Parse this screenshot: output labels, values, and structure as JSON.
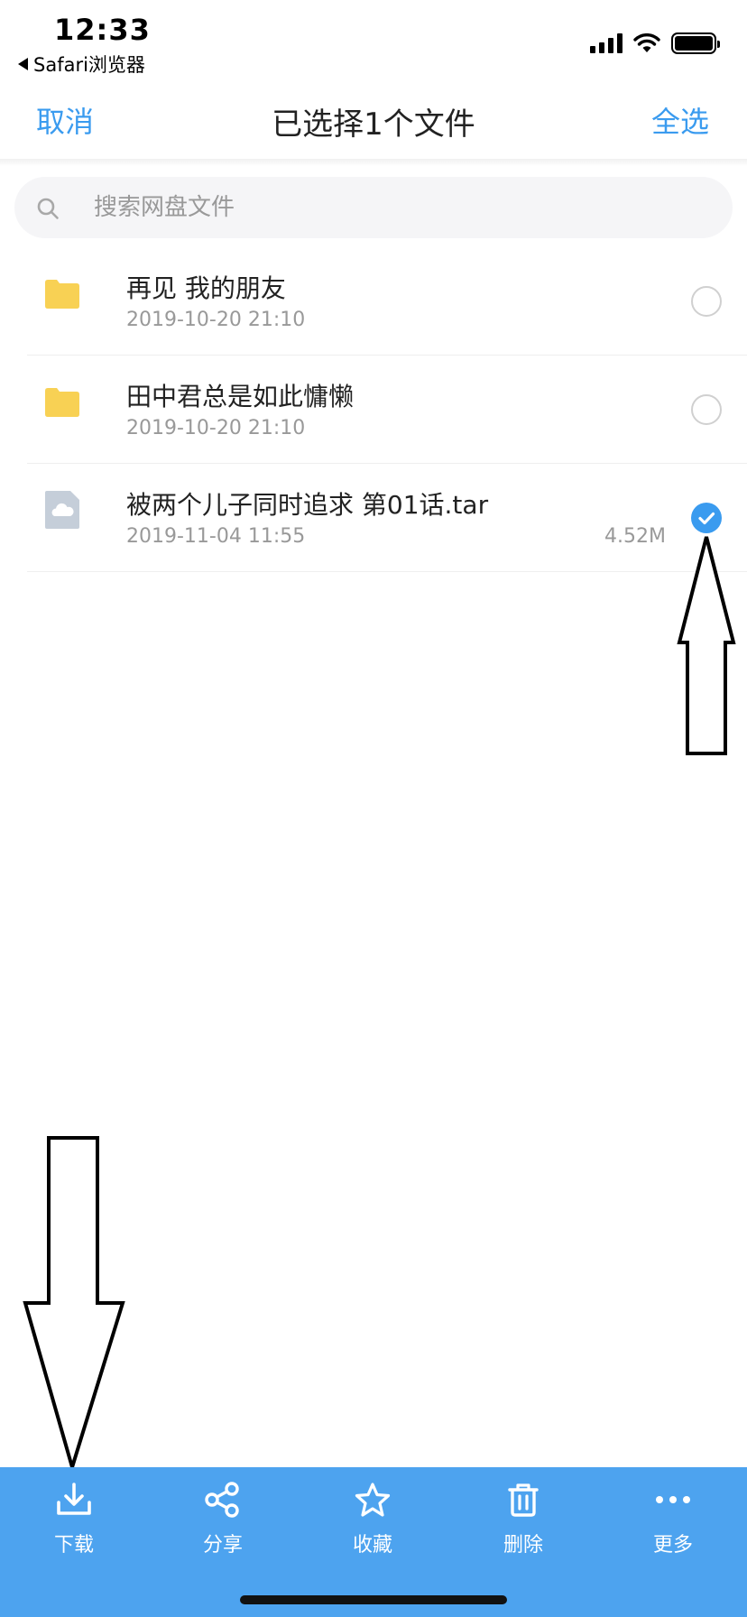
{
  "status_bar": {
    "time": "12:33",
    "back_app": "Safari浏览器",
    "signal_icon": "cellular-signal-icon",
    "wifi_icon": "wifi-icon",
    "battery_icon": "battery-icon"
  },
  "header": {
    "cancel_label": "取消",
    "title": "已选择1个文件",
    "select_all_label": "全选"
  },
  "search": {
    "placeholder": "搜索网盘文件",
    "value": ""
  },
  "files": [
    {
      "name": "再见 我的朋友",
      "date": "2019-10-20 21:10",
      "size": "",
      "type": "folder",
      "selected": false
    },
    {
      "name": "田中君总是如此慵懒",
      "date": "2019-10-20 21:10",
      "size": "",
      "type": "folder",
      "selected": false
    },
    {
      "name": "被两个儿子同时追求 第01话.tar",
      "date": "2019-11-04 11:55",
      "size": "4.52M",
      "type": "archive",
      "selected": true
    }
  ],
  "toolbar": {
    "download_label": "下载",
    "share_label": "分享",
    "favorite_label": "收藏",
    "delete_label": "删除",
    "more_label": "更多"
  },
  "colors": {
    "accent": "#3a9bef",
    "toolbar_bg": "#4da3ef",
    "folder": "#f8d154",
    "file_icon": "#c5ced9"
  }
}
